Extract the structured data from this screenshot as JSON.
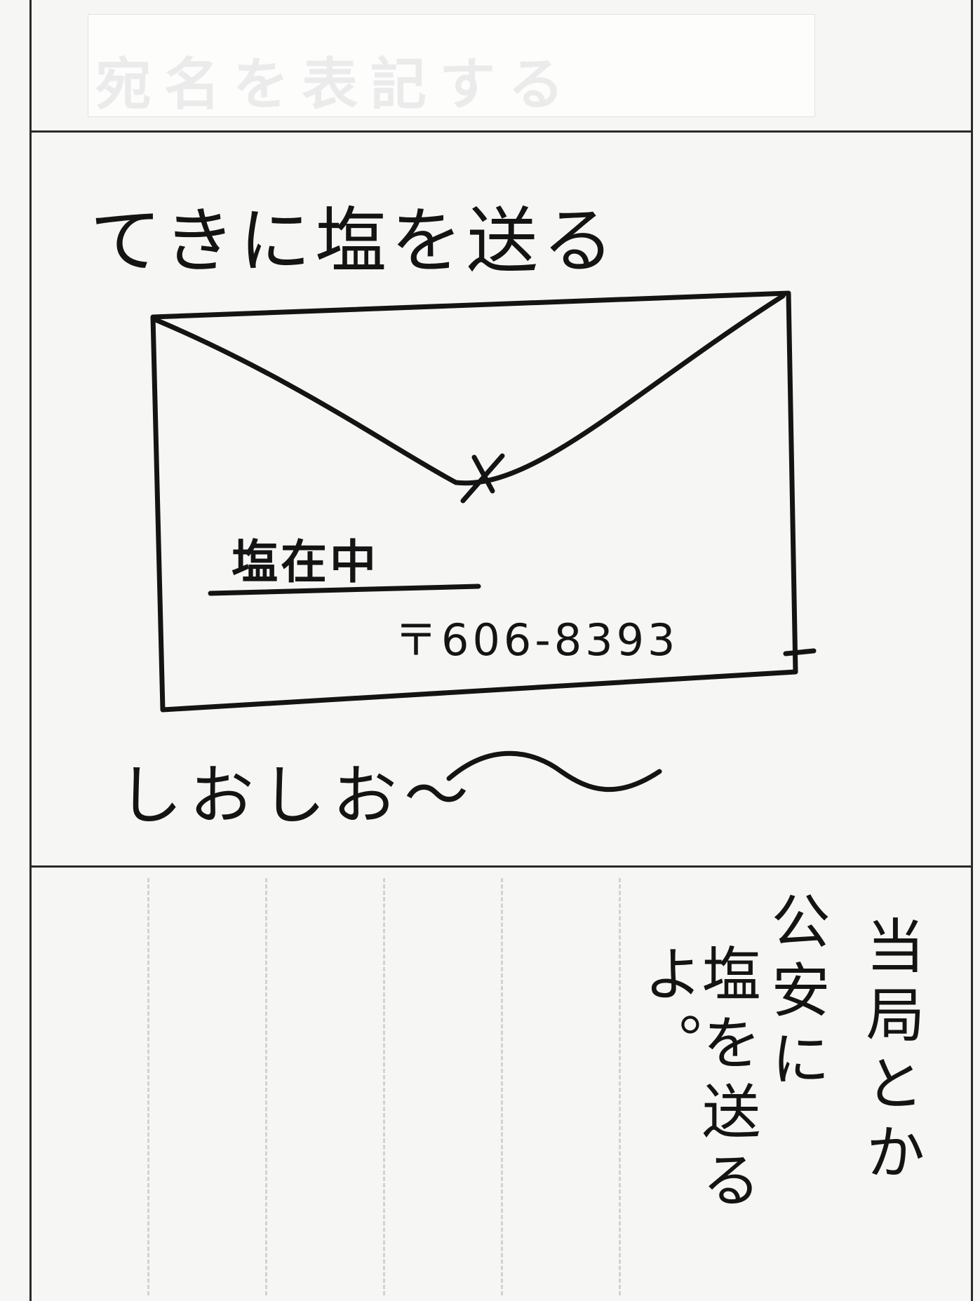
{
  "top_section": {
    "masked_title": "宛名を表記する"
  },
  "drawing": {
    "heading": "てきに塩を送る",
    "envelope": {
      "name": "塩在中",
      "postal_code": "〒606-8393"
    },
    "exclamation": "しおしお〜"
  },
  "note": {
    "columns": [
      "当局とか",
      "公安に",
      "塩を送るよ。"
    ]
  },
  "colors": {
    "ink": "#141414",
    "paper": "#f6f6f4",
    "rule": "#2a2a2a",
    "guide": "#d2d2d2"
  }
}
